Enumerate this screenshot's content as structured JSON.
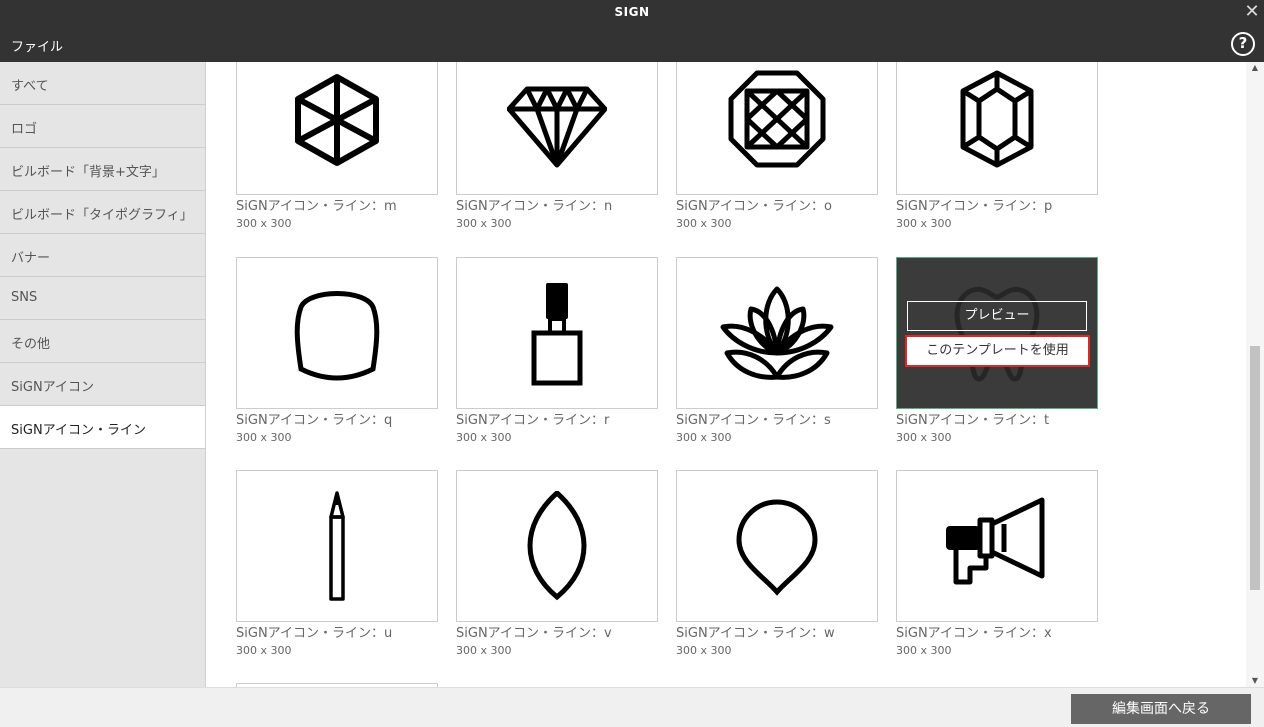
{
  "window": {
    "title": "SIGN"
  },
  "menubar": {
    "file_label": "ファイル",
    "help_label": "?"
  },
  "sidebar": {
    "items": [
      {
        "label": "すべて"
      },
      {
        "label": "ロゴ"
      },
      {
        "label": "ビルボード「背景+文字」"
      },
      {
        "label": "ビルボード「タイポグラフィ」"
      },
      {
        "label": "バナー"
      },
      {
        "label": "SNS"
      },
      {
        "label": "その他"
      },
      {
        "label": "SiGNアイコン"
      },
      {
        "label": "SiGNアイコン・ライン"
      }
    ],
    "active_index": 8
  },
  "templates": [
    {
      "name": "SiGNアイコン・ライン：m",
      "size": "300 x 300",
      "icon": "hexagon-cube-icon"
    },
    {
      "name": "SiGNアイコン・ライン：n",
      "size": "300 x 300",
      "icon": "diamond-icon"
    },
    {
      "name": "SiGNアイコン・ライン：o",
      "size": "300 x 300",
      "icon": "octagon-gem-icon"
    },
    {
      "name": "SiGNアイコン・ライン：p",
      "size": "300 x 300",
      "icon": "emerald-gem-icon"
    },
    {
      "name": "SiGNアイコン・ライン：q",
      "size": "300 x 300",
      "icon": "fingernail-icon"
    },
    {
      "name": "SiGNアイコン・ライン：r",
      "size": "300 x 300",
      "icon": "nail-polish-icon"
    },
    {
      "name": "SiGNアイコン・ライン：s",
      "size": "300 x 300",
      "icon": "lotus-icon"
    },
    {
      "name": "SiGNアイコン・ライン：t",
      "size": "300 x 300",
      "icon": "tooth-icon"
    },
    {
      "name": "SiGNアイコン・ライン：u",
      "size": "300 x 300",
      "icon": "pencil-icon"
    },
    {
      "name": "SiGNアイコン・ライン：v",
      "size": "300 x 300",
      "icon": "leaf-shape-icon"
    },
    {
      "name": "SiGNアイコン・ライン：w",
      "size": "300 x 300",
      "icon": "drop-shape-icon"
    },
    {
      "name": "SiGNアイコン・ライン：x",
      "size": "300 x 300",
      "icon": "megaphone-icon"
    }
  ],
  "hover_overlay": {
    "preview_label": "プレビュー",
    "use_label": "このテンプレートを使用"
  },
  "bottombar": {
    "back_label": "編集画面へ戻る"
  },
  "colors": {
    "header_bg": "#333333",
    "sidebar_bg": "#e5e5e5",
    "highlight_border": "#d92a2a",
    "button_bg": "#666666"
  }
}
